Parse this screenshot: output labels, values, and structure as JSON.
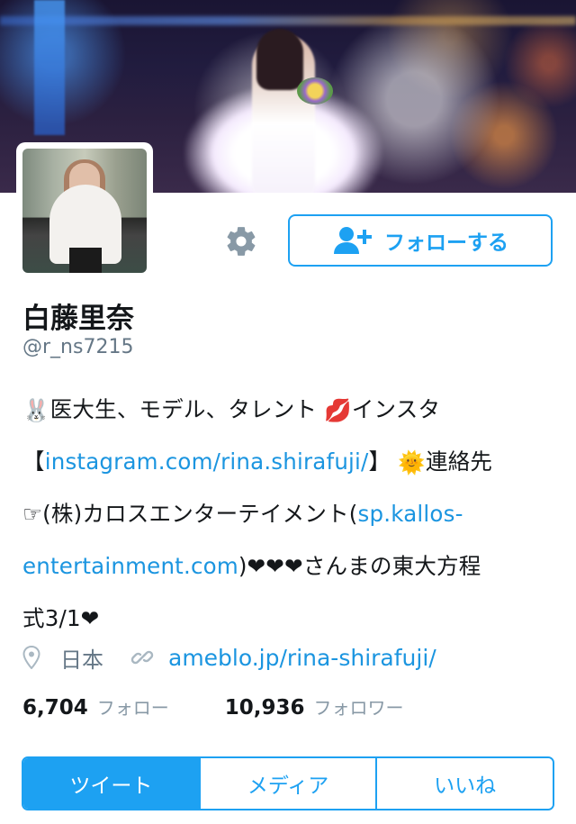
{
  "profile": {
    "display_name": "白藤里奈",
    "handle": "@r_ns7215",
    "location": "日本",
    "website": "ameblo.jp/rina-shirafuji/"
  },
  "actions": {
    "settings_icon": "gear-icon",
    "follow_label": "フォローする",
    "follow_icon": "add-user-icon"
  },
  "bio": {
    "line1": {
      "emoji1": "🐰",
      "text1": "医大生、モデル、タレント ",
      "emoji2": "💋",
      "text2": "インスタ"
    },
    "line2": {
      "open": "【",
      "link": "instagram.com/rina.shirafuji/",
      "close": "】 ",
      "emoji": "🌞",
      "text": "連絡先"
    },
    "line3": {
      "hand": "☞",
      "text": "(株)カロスエンターテイメント(",
      "link": "sp.kallos-"
    },
    "line4": {
      "link": "entertainment.com",
      "text": ")❤❤❤さんまの東大方程"
    },
    "line5": {
      "text": "式3/1❤"
    }
  },
  "stats": {
    "following_count": "6,704",
    "following_label": "フォロー",
    "followers_count": "10,936",
    "followers_label": "フォロワー"
  },
  "tabs": [
    {
      "label": "ツイート",
      "active": true
    },
    {
      "label": "メディア",
      "active": false
    },
    {
      "label": "いいね",
      "active": false
    }
  ],
  "colors": {
    "accent": "#1da1f2",
    "link": "#1b95e0",
    "muted": "#657786",
    "text": "#14171a"
  }
}
